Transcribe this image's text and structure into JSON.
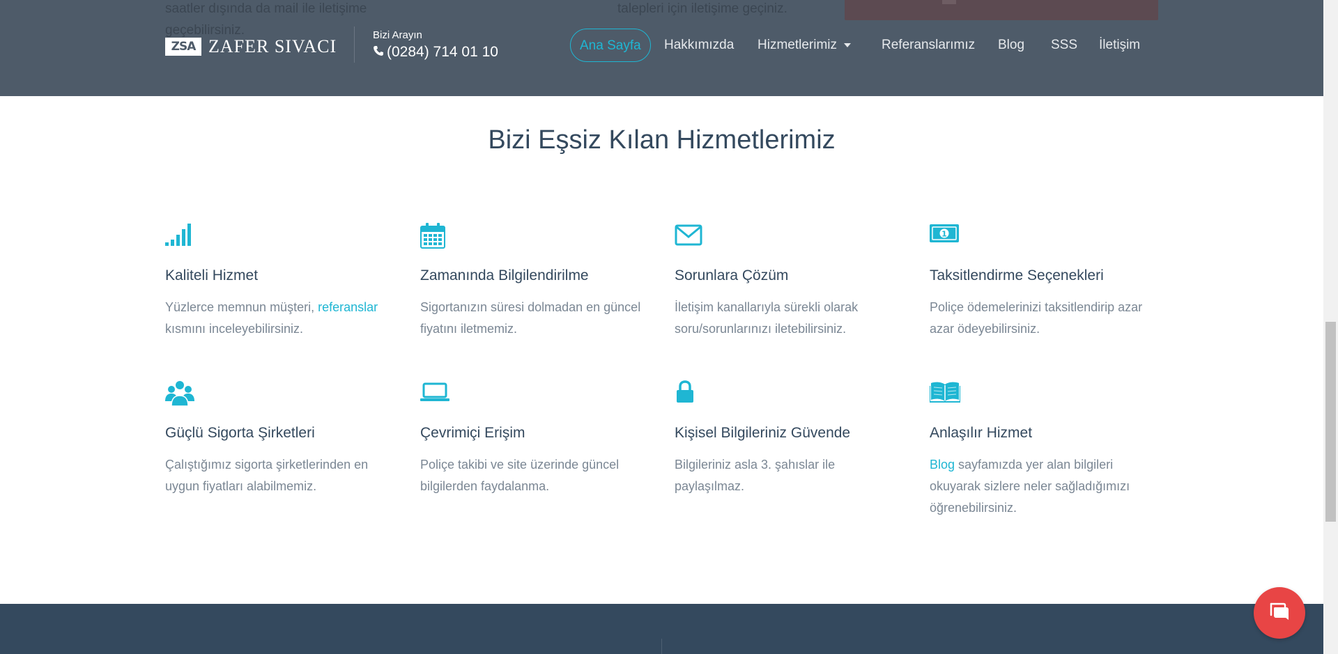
{
  "header": {
    "bg_left_text": "saatler dışında da mail ile iletişime geçebilirsiniz.",
    "bg_mid_text": "talepleri için iletişime geçiniz.",
    "logo_mark": "ZSA",
    "logo_text": "ZAFER SIVACI",
    "call_label": "Bizi Arayın",
    "phone": "(0284) 714 01 10",
    "nav": [
      {
        "label": "Ana Sayfa",
        "active": true
      },
      {
        "label": "Hakkımızda"
      },
      {
        "label": "Hizmetlerimiz"
      },
      {
        "label": "Referanslarımız"
      },
      {
        "label": "Blog"
      },
      {
        "label": "SSS"
      },
      {
        "label": "İletişim"
      }
    ]
  },
  "main": {
    "title": "Bizi Eşsiz Kılan Hizmetlerimiz",
    "features": [
      {
        "icon": "signal-bars-icon",
        "title": "Kaliteli Hizmet",
        "text_before": "Yüzlerce memnun müşteri, ",
        "link": "referanslar",
        "text_after": " kısmını inceleyebilirsiniz."
      },
      {
        "icon": "calendar-icon",
        "title": "Zamanında Bilgilendirilme",
        "text": "Sigortanızın süresi dolmadan en güncel fiyatını iletmemiz."
      },
      {
        "icon": "envelope-icon",
        "title": "Sorunlara Çözüm",
        "text": "İletişim kanallarıyla sürekli olarak soru/sorunlarınızı iletebilirsiniz."
      },
      {
        "icon": "money-bill-icon",
        "title": "Taksitlendirme Seçenekleri",
        "text": "Poliçe ödemelerinizi taksitlendirip azar azar ödeyebilirsiniz."
      },
      {
        "icon": "users-icon",
        "title": "Güçlü Sigorta Şirketleri",
        "text": "Çalıştığımız sigorta şirketlerinden en uygun fiyatları alabilmemiz."
      },
      {
        "icon": "laptop-icon",
        "title": "Çevrimiçi Erişim",
        "text": "Poliçe takibi ve site üzerinde güncel bilgilerden faydalanma."
      },
      {
        "icon": "lock-icon",
        "title": "Kişisel Bilgileriniz Güvende",
        "text": "Bilgileriniz asla 3. şahıslar ile paylaşılmaz."
      },
      {
        "icon": "open-book-icon",
        "title": "Anlaşılır Hizmet",
        "link": "Blog",
        "text_after": " sayfamızda yer alan bilgileri okuyarak sizlere neler sağladığımızı öğrenebilirsiniz."
      }
    ]
  },
  "chat": {
    "icon": "chat-bubbles-icon"
  },
  "colors": {
    "accent": "#1fb6d3",
    "header_bg": "#4e5b69",
    "footer_bg": "#34495e",
    "chat_bg": "#e84545"
  }
}
